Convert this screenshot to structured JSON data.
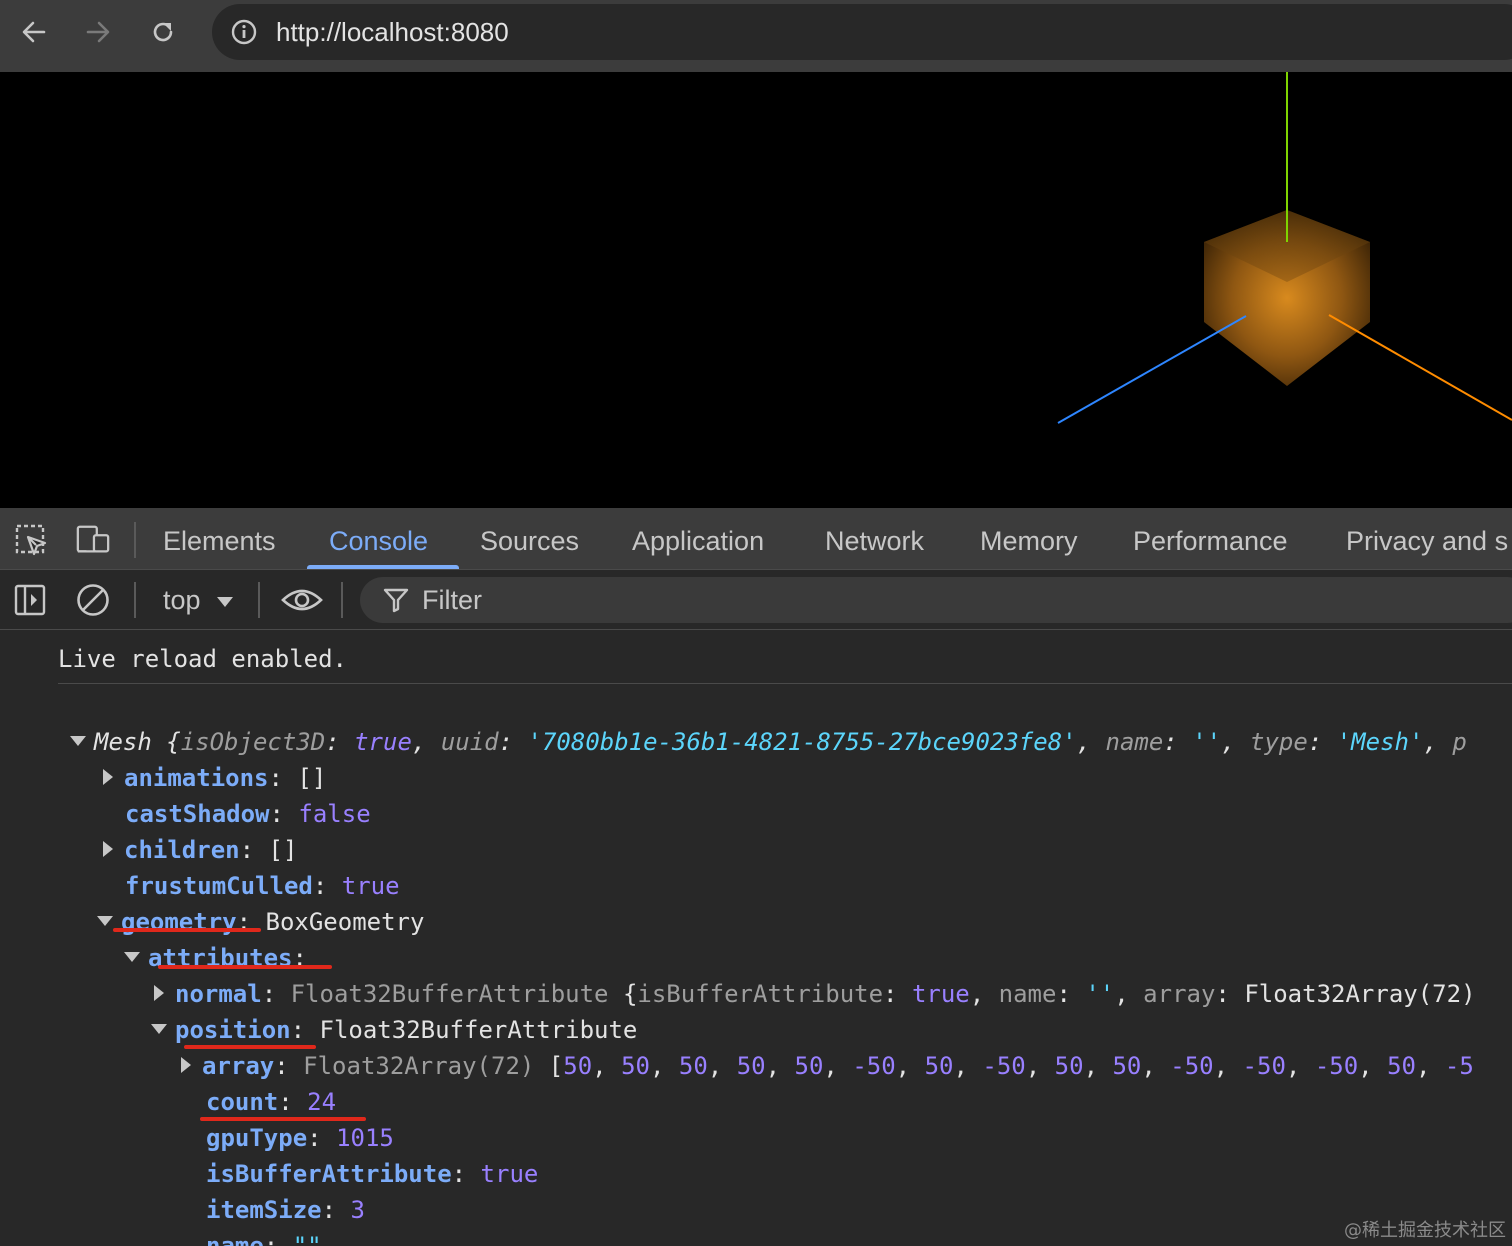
{
  "browser": {
    "url": "http://localhost:8080",
    "icons": [
      "back-icon",
      "forward-icon",
      "reload-icon",
      "site-info-icon"
    ]
  },
  "devtools": {
    "icons": [
      "inspect-element-icon",
      "device-toolbar-icon"
    ],
    "tabs": [
      {
        "label": "Elements"
      },
      {
        "label": "Console"
      },
      {
        "label": "Sources"
      },
      {
        "label": "Application"
      },
      {
        "label": "Network"
      },
      {
        "label": "Memory"
      },
      {
        "label": "Performance"
      },
      {
        "label": "Privacy and s"
      }
    ],
    "active_tab": "Console",
    "accent": "#7cacf8"
  },
  "console_toolbar": {
    "context": "top",
    "filter_placeholder": "Filter",
    "icons": [
      "sidebar-toggle-icon",
      "clear-console-icon",
      "dropdown-arrow-icon",
      "live-expression-eye-icon",
      "filter-icon"
    ]
  },
  "console": {
    "message": "Live reload enabled.",
    "mesh": {
      "class": "Mesh",
      "preview": {
        "isObject3D_key": "isObject3D",
        "isObject3D_val": "true",
        "uuid_key": "uuid",
        "uuid_val": "'7080bb1e-36b1-4821-8755-27bce9023fe8'",
        "name_key": "name",
        "name_val": "''",
        "type_key": "type",
        "type_val": "'Mesh'",
        "tail": "p"
      },
      "animations": {
        "key": "animations",
        "val": "[]"
      },
      "castShadow": {
        "key": "castShadow",
        "val": "false"
      },
      "children": {
        "key": "children",
        "val": "[]"
      },
      "frustumCulled": {
        "key": "frustumCulled",
        "val": "true"
      },
      "geometry": {
        "key": "geometry",
        "val": "BoxGeometry"
      },
      "attributes": {
        "key": "attributes"
      },
      "normal": {
        "key": "normal",
        "class": "Float32BufferAttribute",
        "p1k": "isBufferAttribute",
        "p1v": "true",
        "p2k": "name",
        "p2v": "''",
        "p3k": "array",
        "p3v": "Float32Array(72)"
      },
      "position": {
        "key": "position",
        "val": "Float32BufferAttribute"
      },
      "array": {
        "key": "array",
        "type": "Float32Array(72)",
        "values": [
          "50",
          "50",
          "50",
          "50",
          "50",
          "-50",
          "50",
          "-50",
          "50",
          "50",
          "-50",
          "-50",
          "-50",
          "50",
          "-5"
        ]
      },
      "count": {
        "key": "count",
        "val": "24"
      },
      "gpuType": {
        "key": "gpuType",
        "val": "1015"
      },
      "isBufferAttribute": {
        "key": "isBufferAttribute",
        "val": "true"
      },
      "itemSize": {
        "key": "itemSize",
        "val": "3"
      },
      "name": {
        "key": "name",
        "val": "\"\""
      }
    }
  },
  "scene": {
    "axis_colors": {
      "x": "#ff8c00",
      "y": "#7fd400",
      "z": "#2e86ff"
    },
    "cube_color": "#b8741a"
  },
  "watermark": "@稀土掘金技术社区"
}
